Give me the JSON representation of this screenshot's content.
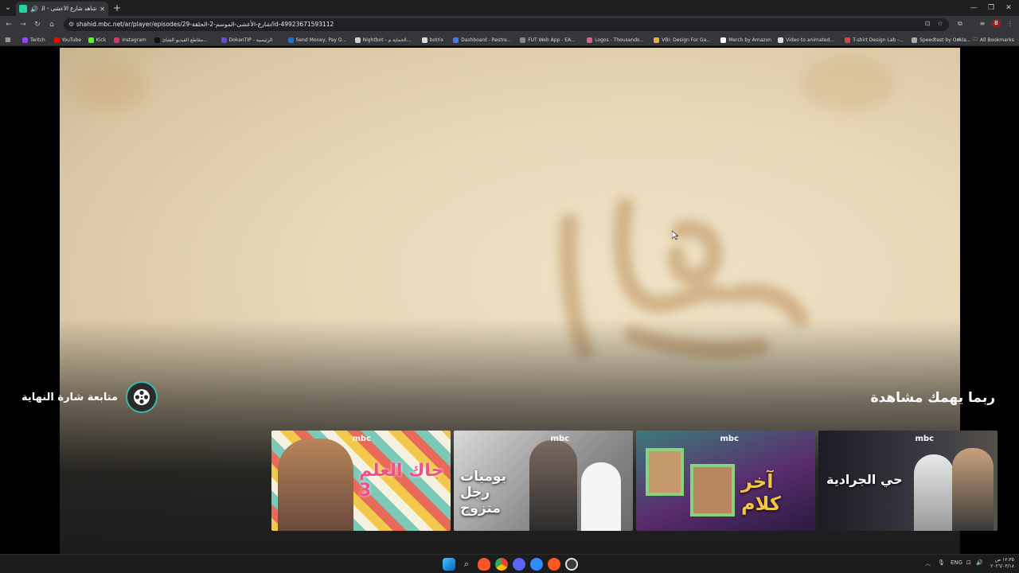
{
  "browser": {
    "tab": {
      "title": "شاهد شارع الأعشى - الموسـ"
    },
    "url": "shahid.mbc.net/ar/player/episodes/شارع-الأعشى-الموسم-2-الحلقة-29/id-49923671593112",
    "bookmarks": [
      {
        "label": "Twitch",
        "color": "#9146ff"
      },
      {
        "label": "YouTube",
        "color": "#ff0000"
      },
      {
        "label": "Kick",
        "color": "#53fc18"
      },
      {
        "label": "Instagram",
        "color": "#e1306c"
      },
      {
        "label": "مقاطع الفيديو الشائ...",
        "color": "#111111"
      },
      {
        "label": "DokanTIP - الرئيسية",
        "color": "#6a4bc4"
      },
      {
        "label": "Send Money, Pay O...",
        "color": "#1f6fd1"
      },
      {
        "label": "Nightbot - الحماية م...",
        "color": "#cfcfcf"
      },
      {
        "label": "botrix",
        "color": "#dddddd"
      },
      {
        "label": "Dashboard - Restre...",
        "color": "#3b7cf5"
      },
      {
        "label": "FUT Web App - EA...",
        "color": "#888888"
      },
      {
        "label": "Logos - Thousands...",
        "color": "#e05a8c"
      },
      {
        "label": "VBI: Design For Ga...",
        "color": "#e3b03a"
      },
      {
        "label": "Merch by Amazon",
        "color": "#ffffff"
      },
      {
        "label": "Video to animated...",
        "color": "#dddddd"
      },
      {
        "label": "T-shirt Design Lab -...",
        "color": "#d9443b"
      },
      {
        "label": "Speedtest by Ookla...",
        "color": "#aaaaaa"
      }
    ],
    "all_bookmarks": "All Bookmarks",
    "profile_initial": "B"
  },
  "player": {
    "end_credits_label": "متابعة شارة النهاية",
    "recommendations_title": "ربما يهمك مشاهدة",
    "cards": [
      {
        "title": "جاك العلم 3",
        "brand": "mbc",
        "bg": "#f0d35a"
      },
      {
        "title": "يوميات رجل متزوج",
        "brand": "mbc",
        "bg": "#8c8c8c"
      },
      {
        "title": "آخر كلام",
        "brand": "mbc",
        "bg": "#5a2d6e"
      },
      {
        "title": "حي الجرادية",
        "brand": "mbc",
        "bg": "#2a2a33"
      }
    ]
  },
  "taskbar": {
    "lang": "ENG",
    "time": "١٢:٣٥ ص",
    "date": "٢٠٢٦/٠٣/١٨"
  }
}
